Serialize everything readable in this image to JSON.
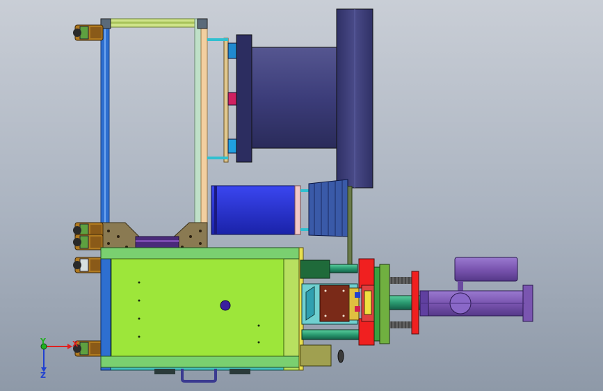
{
  "viewport": {
    "background_top": "#c9ced6",
    "background_bottom": "#8e99a8"
  },
  "triad": {
    "x_label": "X",
    "y_label": "Y",
    "z_label": "Z",
    "x_color": "#e02020",
    "y_color": "#20b020",
    "z_color": "#2040d0"
  },
  "model": {
    "frame_color": "#2e6fd0",
    "frame_top_rail_color": "#cfe48a",
    "base_plate_color": "#9de63a",
    "drum_color": "#3c3d7a",
    "motor_color": "#2530d0",
    "cylinder_color": "#7a55b0",
    "clamp_color": "#f02020",
    "gusset_color": "#8a7a52",
    "caster_color": "#b07a20"
  }
}
